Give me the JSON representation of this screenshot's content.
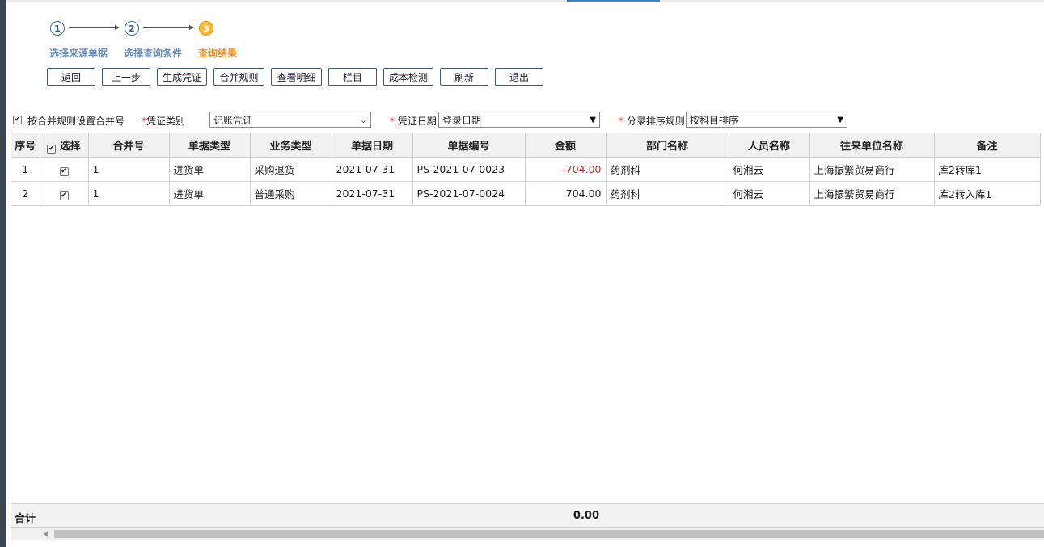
{
  "steps": [
    {
      "num": "1",
      "label": "选择来源单据"
    },
    {
      "num": "2",
      "label": "选择查询条件"
    },
    {
      "num": "3",
      "label": "查询结果"
    }
  ],
  "toolbar": {
    "back": "返回",
    "prev_step": "上一步",
    "generate_voucher": "生成凭证",
    "merge_rules": "合并规则",
    "view_detail": "查看明细",
    "columns": "栏目",
    "cost_check": "成本检测",
    "refresh": "刷新",
    "exit": "退出"
  },
  "filters": {
    "merge_by_rule_label": "按合并规则设置合并号",
    "merge_by_rule_checked": true,
    "voucher_type_label": "凭证类别",
    "voucher_type_value": "记账凭证",
    "voucher_date_label": "凭证日期",
    "voucher_date_value": "登录日期",
    "entry_sort_label": "分录排序规则",
    "entry_sort_value": "按科目排序",
    "required_mark": "*"
  },
  "table": {
    "headers": {
      "seq": "序号",
      "select": "选择",
      "merge_no": "合并号",
      "doc_type": "单据类型",
      "biz_type": "业务类型",
      "doc_date": "单据日期",
      "doc_no": "单据编号",
      "amount": "金额",
      "dept": "部门名称",
      "person": "人员名称",
      "partner": "往来单位名称",
      "remark": "备注"
    },
    "rows": [
      {
        "seq": "1",
        "checked": true,
        "merge_no": "1",
        "doc_type": "进货单",
        "biz_type": "采购退货",
        "doc_date": "2021-07-31",
        "doc_no": "PS-2021-07-0023",
        "amount": "-704.00",
        "dept": "药剂科",
        "person": "何湘云",
        "partner": "上海振繁贸易商行",
        "remark": "库2转库1"
      },
      {
        "seq": "2",
        "checked": true,
        "merge_no": "1",
        "doc_type": "进货单",
        "biz_type": "普通采购",
        "doc_date": "2021-07-31",
        "doc_no": "PS-2021-07-0024",
        "amount": "704.00",
        "dept": "药剂科",
        "person": "何湘云",
        "partner": "上海振繁贸易商行",
        "remark": "库2转入库1"
      }
    ],
    "footer": {
      "label": "合计",
      "amount_total": "0.00"
    }
  },
  "colors": {
    "accent": "#3d7fd1",
    "active_step": "#f7b835",
    "negative": "#d42a2a"
  }
}
